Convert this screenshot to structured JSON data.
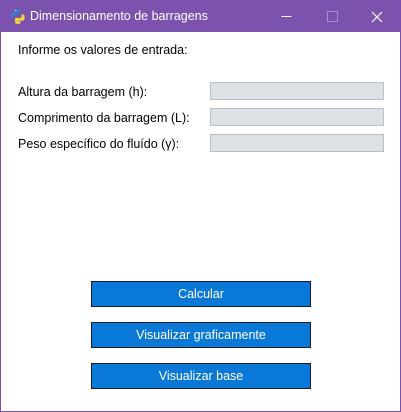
{
  "window": {
    "title": "Dimensionamento de barragens",
    "controls": {
      "minimize": "minimize-icon",
      "maximize": "maximize-icon",
      "close": "close-icon"
    },
    "colors": {
      "titlebar": "#7b52ae",
      "button": "#0a78d7",
      "input_bg": "#dde1e6"
    }
  },
  "form": {
    "prompt": "Informe os valores de entrada:",
    "fields": [
      {
        "label": "Altura da barragem (h):",
        "value": ""
      },
      {
        "label": "Comprimento da barragem (L):",
        "value": ""
      },
      {
        "label": "Peso específico do fluído (γ):",
        "value": ""
      }
    ]
  },
  "buttons": {
    "calcular": "Calcular",
    "visualizar_graficamente": "Visualizar graficamente",
    "visualizar_base": "Visualizar base"
  }
}
